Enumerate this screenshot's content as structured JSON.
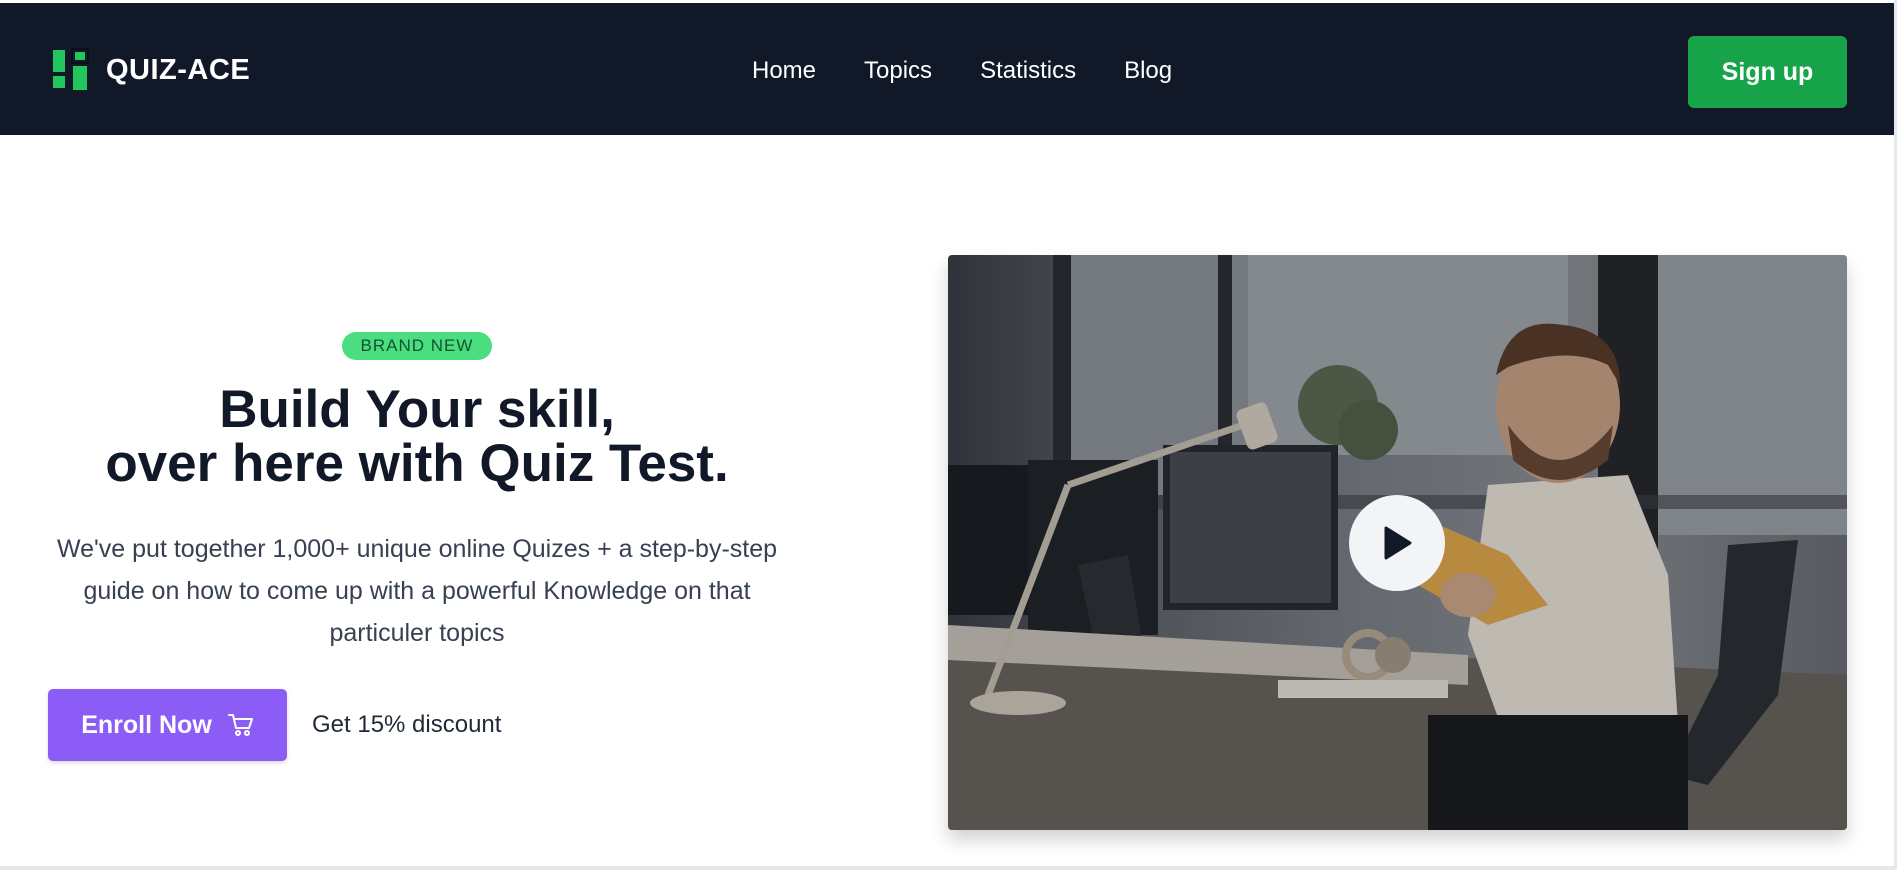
{
  "header": {
    "brand_name": "QUIZ-ACE",
    "logo_icon": "quiz-ace-logo-icon",
    "nav": [
      {
        "label": "Home"
      },
      {
        "label": "Topics"
      },
      {
        "label": "Statistics"
      },
      {
        "label": "Blog"
      }
    ],
    "signup_label": "Sign up"
  },
  "hero": {
    "badge": "BRAND NEW",
    "headline_line1": "Build Your skill,",
    "headline_line2": "over here with Quiz Test.",
    "description": "We've put together 1,000+ unique online Quizes + a step-by-step guide on how to come up with a powerful Knowledge on that particuler topics",
    "enroll_label": "Enroll Now",
    "enroll_icon": "cart-icon",
    "discount_text": "Get 15% discount",
    "video_play_icon": "play-icon"
  },
  "colors": {
    "nav_bg": "#111827",
    "signup_bg": "#16a34a",
    "badge_bg": "#4ade80",
    "enroll_bg": "#8b5cf6",
    "brand_accent": "#22c55e"
  }
}
